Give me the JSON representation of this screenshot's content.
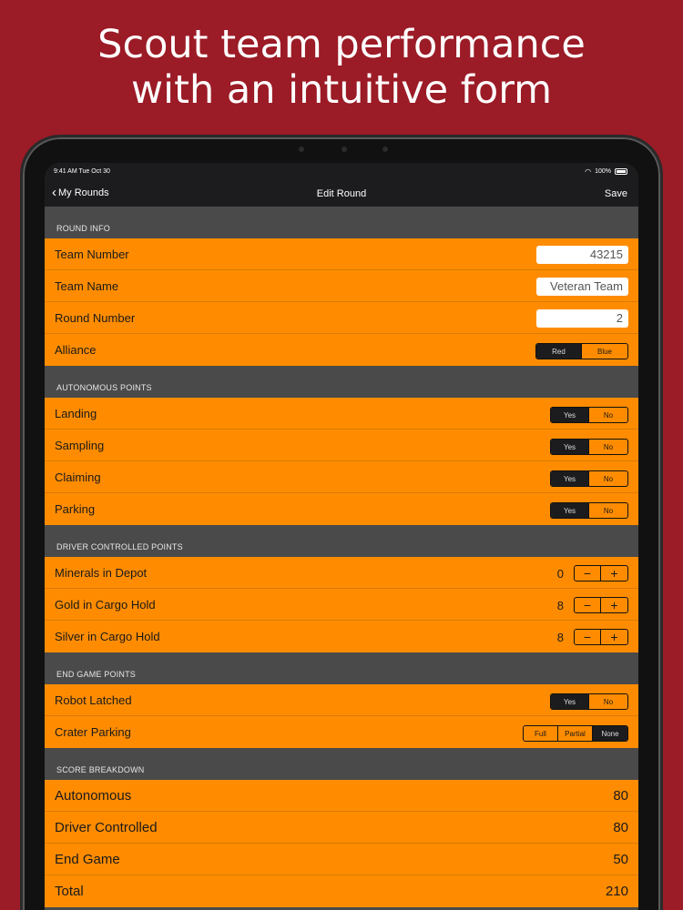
{
  "headline": {
    "line1": "Scout team performance",
    "line2": "with an intuitive form"
  },
  "status": {
    "time": "9:41 AM  Tue Oct 30",
    "battery": "100%"
  },
  "nav": {
    "back_label": "My Rounds",
    "title": "Edit Round",
    "save_label": "Save"
  },
  "round_info": {
    "header": "ROUND INFO",
    "team_number": {
      "label": "Team Number",
      "value": "43215"
    },
    "team_name": {
      "label": "Team Name",
      "value": "Veteran Team"
    },
    "round_number": {
      "label": "Round Number",
      "value": "2"
    },
    "alliance": {
      "label": "Alliance",
      "options": [
        "Red",
        "Blue"
      ],
      "selected": "Red"
    }
  },
  "autonomous": {
    "header": "AUTONOMOUS POINTS",
    "yes": "Yes",
    "no": "No",
    "landing": "Landing",
    "sampling": "Sampling",
    "claiming": "Claiming",
    "parking": "Parking"
  },
  "driver": {
    "header": "DRIVER CONTROLLED POINTS",
    "minus": "−",
    "plus": "+",
    "minerals": {
      "label": "Minerals in Depot",
      "value": "0"
    },
    "gold": {
      "label": "Gold in Cargo Hold",
      "value": "8"
    },
    "silver": {
      "label": "Silver in Cargo Hold",
      "value": "8"
    }
  },
  "endgame": {
    "header": "END GAME POINTS",
    "robot_latched": {
      "label": "Robot Latched",
      "yes": "Yes",
      "no": "No"
    },
    "crater_parking": {
      "label": "Crater Parking",
      "options": [
        "Full",
        "Partial",
        "None"
      ],
      "selected": "None"
    }
  },
  "score": {
    "header": "SCORE BREAKDOWN",
    "autonomous": {
      "label": "Autonomous",
      "value": "80"
    },
    "driver": {
      "label": "Driver Controlled",
      "value": "80"
    },
    "endgame": {
      "label": "End Game",
      "value": "50"
    },
    "total": {
      "label": "Total",
      "value": "210"
    }
  },
  "colors": {
    "background": "#9b1b26",
    "row": "#ff8c00",
    "section": "#4a4a4a",
    "bar": "#1c1c1e"
  }
}
